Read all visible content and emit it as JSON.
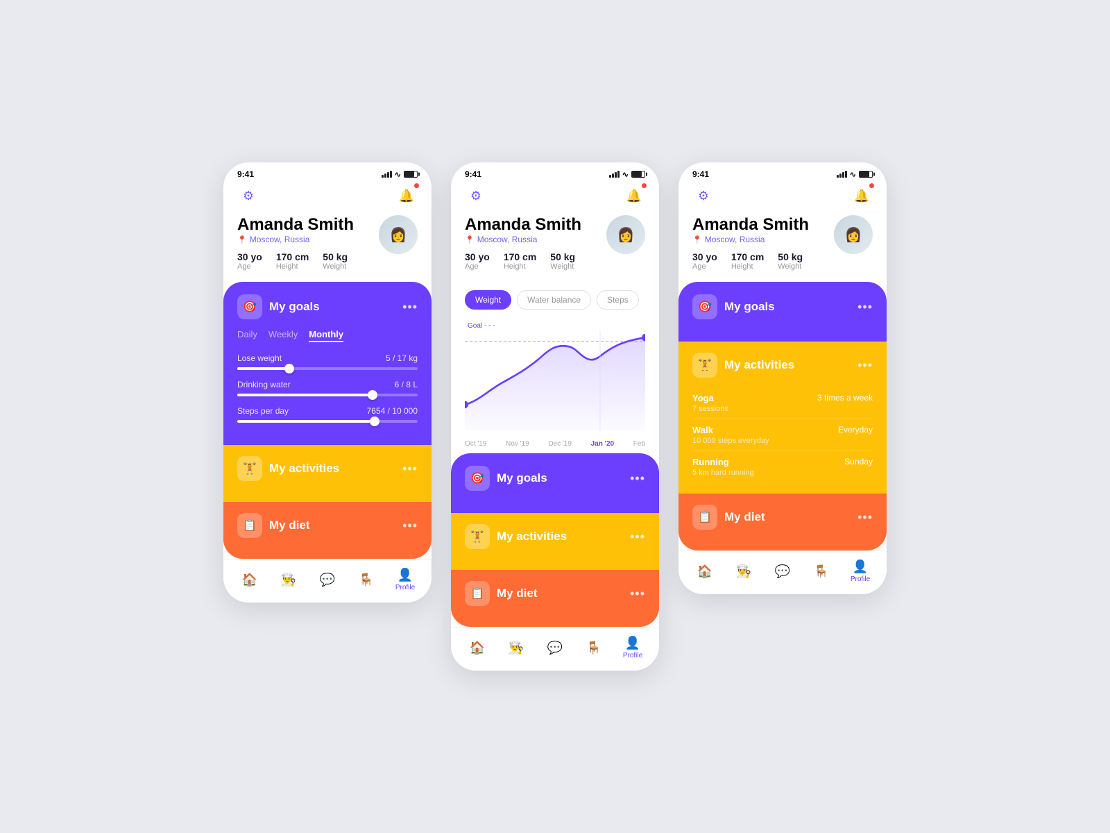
{
  "colors": {
    "purple": "#6c3fff",
    "yellow": "#ffc107",
    "red": "#ff6b35",
    "bg": "#e8eaf0"
  },
  "user": {
    "name": "Amanda Smith",
    "location": "Moscow, Russia",
    "age": "30 yo",
    "age_label": "Age",
    "height": "170 cm",
    "height_label": "Height",
    "weight": "50 kg",
    "weight_label": "Weight"
  },
  "status": {
    "time": "9:41"
  },
  "screen1": {
    "goals_title": "My goals",
    "tabs": [
      "Daily",
      "Weekly",
      "Monthly"
    ],
    "active_tab": "Monthly",
    "goals": [
      {
        "name": "Lose weight",
        "value": "5 / 17 kg",
        "pct": 29
      },
      {
        "name": "Drinking water",
        "value": "6 / 8 L",
        "pct": 75
      },
      {
        "name": "Steps per day",
        "value": "7654 / 10 000",
        "pct": 76
      }
    ],
    "activities_title": "My activities",
    "diet_title": "My diet"
  },
  "screen2": {
    "chart_tabs": [
      "Weight",
      "Water balance",
      "Steps"
    ],
    "active_chart_tab": "Weight",
    "x_labels": [
      "Oct '19",
      "Nov '19",
      "Dec '19",
      "Jan '20",
      "Feb"
    ],
    "highlight_label": "Jan '20",
    "goal_label": "Goal",
    "goals_title": "My goals",
    "activities_title": "My activities",
    "diet_title": "My diet"
  },
  "screen3": {
    "goals_title": "My goals",
    "activities_title": "My activities",
    "diet_title": "My diet",
    "activities": [
      {
        "name": "Yoga",
        "sub": "7 sessions",
        "freq": "3 times a week"
      },
      {
        "name": "Walk",
        "sub": "10 000 steps everyday",
        "freq": "Everyday"
      },
      {
        "name": "Running",
        "sub": "5 km hard running",
        "freq": "Sunday"
      }
    ]
  },
  "nav": {
    "items": [
      "home",
      "chef",
      "chat",
      "furniture",
      "profile"
    ],
    "active": "profile",
    "profile_label": "Profile"
  }
}
